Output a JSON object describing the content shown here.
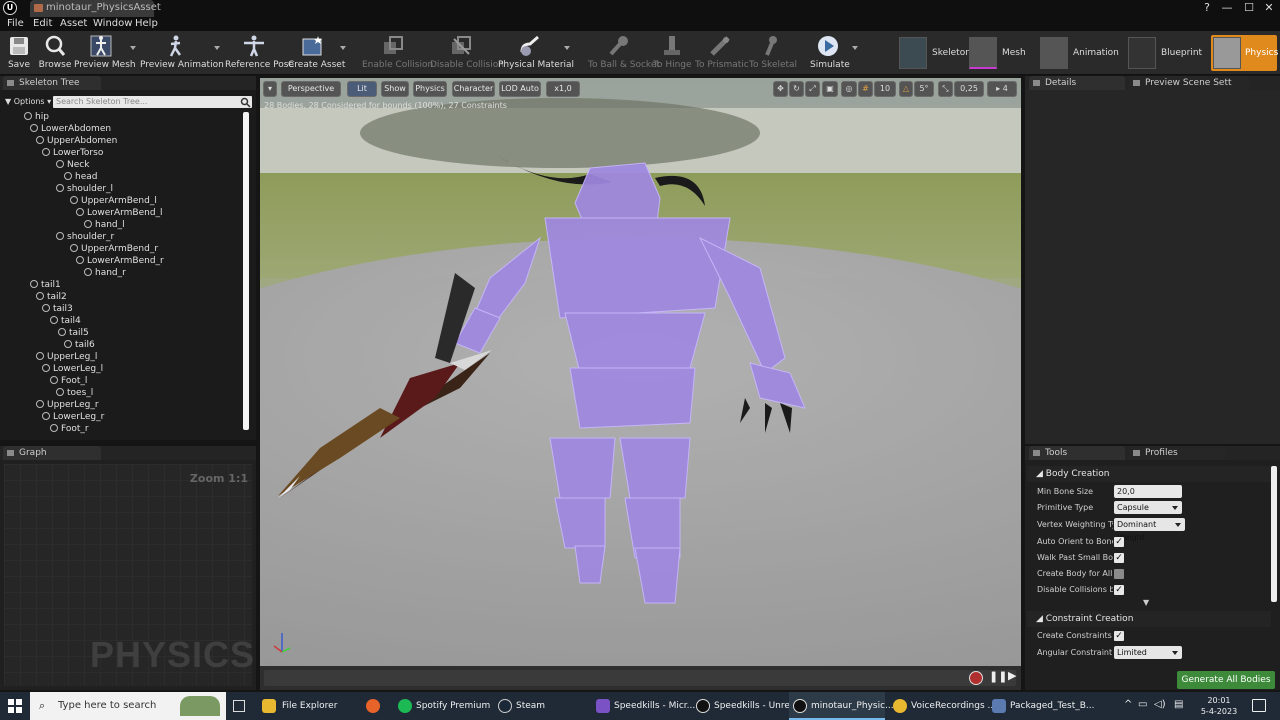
{
  "window": {
    "doc_tab": "minotaur_PhysicsAsset",
    "minimize": "—",
    "maximize": "☐",
    "close": "✕",
    "help": "?"
  },
  "menu": [
    "File",
    "Edit",
    "Asset",
    "Window",
    "Help"
  ],
  "toolbar": {
    "save": "Save",
    "browse": "Browse",
    "preview_mesh": "Preview Mesh",
    "preview_animation": "Preview Animation",
    "reference_pose": "Reference Pose",
    "create_asset": "Create Asset",
    "enable_collision": "Enable Collision",
    "disable_collision": "Disable Collision",
    "physical_material": "Physical Material",
    "to_ball_socket": "To Ball & Socket",
    "to_hinge": "To Hinge",
    "to_prismatic": "To Prismatic",
    "to_skeletal": "To Skeletal",
    "simulate": "Simulate"
  },
  "modes": {
    "skeleton": "Skeleton",
    "mesh": "Mesh",
    "animation": "Animation",
    "blueprint": "Blueprint",
    "physics": "Physics"
  },
  "skeleton_tree": {
    "tab": "Skeleton Tree",
    "options": "Options",
    "search_placeholder": "Search Skeleton Tree...",
    "bones": [
      "hip",
      "LowerAbdomen",
      "UpperAbdomen",
      "LowerTorso",
      "Neck",
      "head",
      "shoulder_l",
      "UpperArmBend_l",
      "LowerArmBend_l",
      "hand_l",
      "shoulder_r",
      "UpperArmBend_r",
      "LowerArmBend_r",
      "hand_r",
      "tail1",
      "tail2",
      "tail3",
      "tail4",
      "tail5",
      "tail6",
      "UpperLeg_l",
      "LowerLeg_l",
      "Foot_l",
      "toes_l",
      "UpperLeg_r",
      "LowerLeg_r",
      "Foot_r"
    ]
  },
  "graph": {
    "tab": "Graph",
    "zoom": "Zoom 1:1",
    "watermark": "PHYSICS"
  },
  "viewport": {
    "perspective": "Perspective",
    "lit": "Lit",
    "show": "Show",
    "physics": "Physics",
    "character": "Character",
    "lod": "LOD Auto",
    "speed": "x1,0",
    "stats": "28 Bodies, 28 Considered for bounds (100%), 27 Constraints",
    "grid_snap": "10",
    "angle_snap": "5°",
    "scale_snap": "0,25",
    "camera_speed": "4"
  },
  "details": {
    "tab_details": "Details",
    "tab_preview": "Preview Scene Sett"
  },
  "tools": {
    "tab_tools": "Tools",
    "tab_profiles": "Profiles",
    "body_creation": "Body Creation",
    "min_bone_size_label": "Min Bone Size",
    "min_bone_size": "20,0",
    "primitive_type_label": "Primitive Type",
    "primitive_type": "Capsule",
    "vertex_weighting_label": "Vertex Weighting Type",
    "vertex_weighting": "Dominant Weight",
    "auto_orient_label": "Auto Orient to Bone",
    "walk_past_label": "Walk Past Small Bone",
    "create_body_all_label": "Create Body for All Bo",
    "disable_collisions_label": "Disable Collisions by D",
    "constraint_creation": "Constraint Creation",
    "create_constraints_label": "Create Constraints",
    "angular_constraint_label": "Angular Constraint Mo",
    "angular_constraint": "Limited",
    "generate": "Generate All Bodies",
    "checks": {
      "auto_orient": true,
      "walk_past": true,
      "create_body_all": false,
      "disable_collisions": true,
      "create_constraints": true
    }
  },
  "taskbar": {
    "search_placeholder": "Type here to search",
    "items": [
      "File Explorer",
      "Spotify Premium",
      "Steam",
      "Speedkills - Micr...",
      "Speedkills - Unre...",
      "minotaur_Physic...",
      "VoiceRecordings ...",
      "Packaged_Test_B..."
    ],
    "time": "20:01",
    "date": "5-4-2023"
  }
}
